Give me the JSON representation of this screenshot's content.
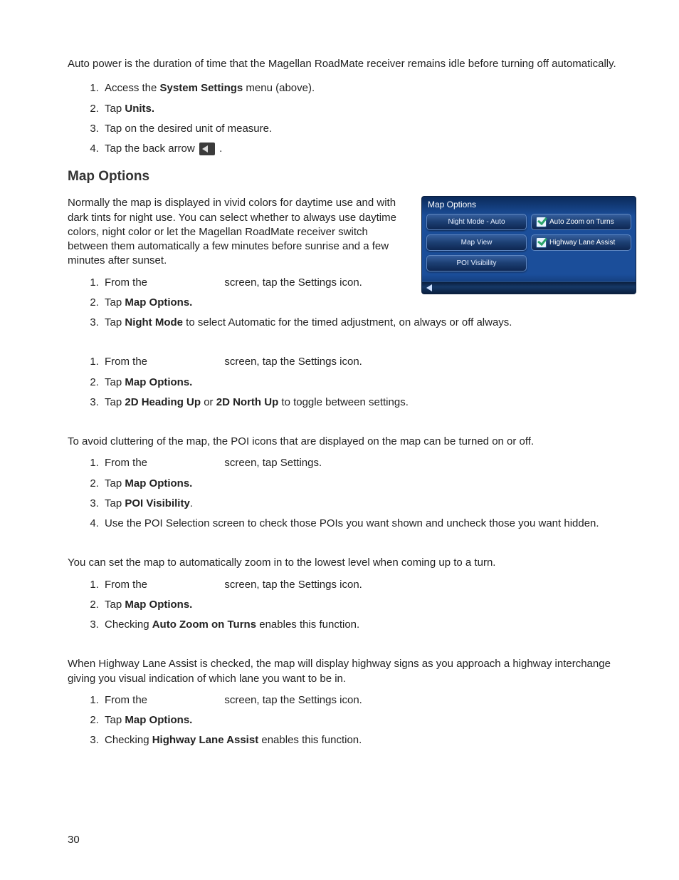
{
  "intro_autopower": "Auto power is the duration of time that the Magellan RoadMate receiver remains idle before turning off automatically.",
  "steps_units": {
    "s1_a": "Access the ",
    "s1_b": "System Settings",
    "s1_c": " menu (above).",
    "s2_a": "Tap ",
    "s2_b": "Units.",
    "s3": "Tap on the desired unit of measure.",
    "s4_a": "Tap the back arrow ",
    "s4_b": " ."
  },
  "heading_map_options": "Map Options",
  "map_intro": "Normally the map is displayed in vivid colors for daytime use and with dark tints for night use. You can select whether to always use daytime colors, night color or let the Magellan RoadMate receiver switch between them automatically a few minutes before sunrise and a few minutes after sunset.",
  "device": {
    "title": "Map Options",
    "btn_night": "Night Mode - Auto",
    "btn_mapview": "Map View",
    "btn_poi": "POI Visibility",
    "chk_autozoom": "Auto Zoom on Turns",
    "chk_hla": "Highway Lane Assist"
  },
  "list_night": {
    "s1_a": "From the ",
    "s1_b": " screen, tap the Settings icon.",
    "s2_a": "Tap ",
    "s2_b": "Map Options.",
    "s3_a": "Tap ",
    "s3_b": "Night Mode",
    "s3_c": " to select Automatic for the timed adjustment, on always or off always."
  },
  "list_heading": {
    "s1_a": "From the ",
    "s1_b": " screen, tap the Settings icon.",
    "s2_a": "Tap ",
    "s2_b": "Map Options.",
    "s3_a": "Tap ",
    "s3_b": "2D Heading Up",
    "s3_c": " or ",
    "s3_d": "2D North Up",
    "s3_e": " to toggle between settings."
  },
  "poi_intro": "To avoid cluttering of the map, the POI icons that are displayed on the map can be turned on or off.",
  "list_poi": {
    "s1_a": "From the ",
    "s1_b": " screen, tap Settings.",
    "s2_a": "Tap ",
    "s2_b": "Map Options.",
    "s3_a": "Tap ",
    "s3_b": "POI Visibility",
    "s3_c": ".",
    "s4": "Use the POI Selection screen to check those POIs you want shown and uncheck those you want hidden."
  },
  "autozoom_intro": "You can set the map to automatically zoom in to the lowest level when coming up to a turn.",
  "list_autozoom": {
    "s1_a": "From the ",
    "s1_b": " screen, tap the Settings icon.",
    "s2_a": "Tap ",
    "s2_b": "Map Options.",
    "s3_a": "Checking ",
    "s3_b": "Auto Zoom on Turns",
    "s3_c": " enables this function."
  },
  "hla_intro": "When Highway Lane Assist is checked, the map will display highway signs as you approach a highway interchange giving you visual indication of which lane you want to be in.",
  "list_hla": {
    "s1_a": "From the ",
    "s1_b": " screen, tap the Settings icon.",
    "s2_a": "Tap ",
    "s2_b": "Map Options.",
    "s3_a": "Checking ",
    "s3_b": "Highway Lane Assist",
    "s3_c": " enables this function."
  },
  "page_number": "30"
}
